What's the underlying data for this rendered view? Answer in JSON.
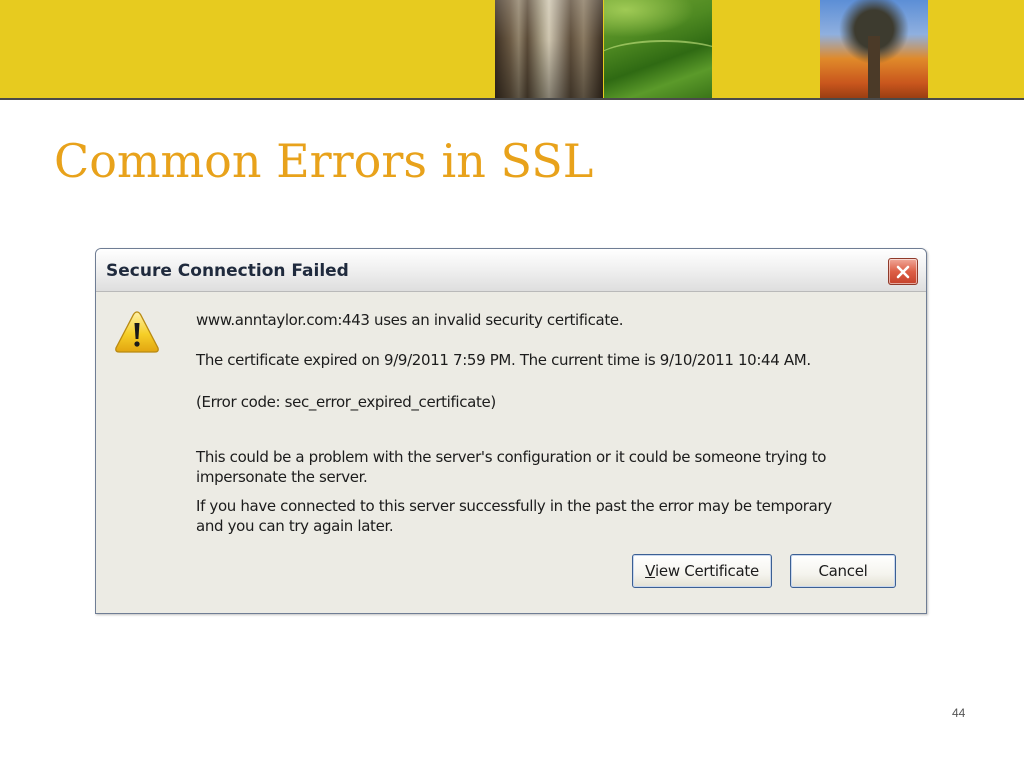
{
  "slide": {
    "title": "Common Errors in SSL",
    "page_number": "44"
  },
  "dialog": {
    "title": "Secure Connection Failed",
    "messages": [
      "www.anntaylor.com:443 uses an invalid security certificate.",
      "The certificate expired on 9/9/2011 7:59 PM. The current time is 9/10/2011 10:44 AM.",
      "(Error code: sec_error_expired_certificate)",
      "This could be a problem with the server's configuration or it could be someone trying to",
      "impersonate the server.",
      "If you have connected to this server successfully in the past the error may be temporary",
      "and you can try again later."
    ],
    "buttons": {
      "view_certificate_accel": "V",
      "view_certificate_rest": "iew Certificate",
      "cancel": "Cancel"
    },
    "icons": {
      "warning": "warning-triangle-icon",
      "close": "close-x-icon"
    }
  },
  "colors": {
    "banner": "#e7cb1f",
    "title": "#e8a21b",
    "close_button": "#dd5f46",
    "warning_fill": "#f6cf28"
  }
}
